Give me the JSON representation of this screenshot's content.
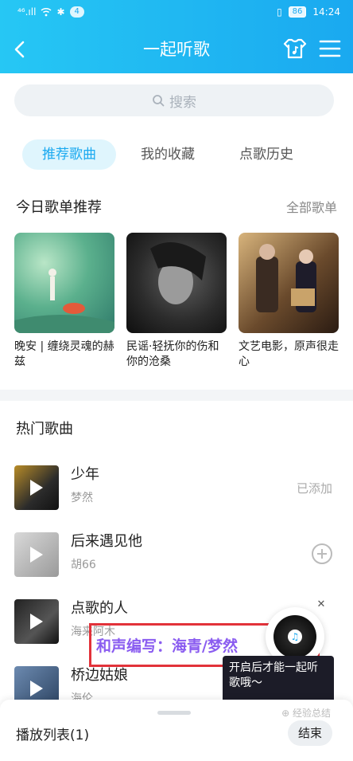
{
  "status_bar": {
    "signal_text": "⁴⁶.ıll",
    "notif_count": "4",
    "battery": "86",
    "time": "14:24"
  },
  "header": {
    "title": "一起听歌",
    "back_icon": "back-chevron-icon",
    "shirt_icon": "tshirt-music-icon",
    "menu_icon": "hamburger-menu-icon"
  },
  "search": {
    "placeholder": "搜索"
  },
  "tabs": [
    {
      "label": "推荐歌曲",
      "active": true
    },
    {
      "label": "我的收藏",
      "active": false
    },
    {
      "label": "点歌历史",
      "active": false
    }
  ],
  "today": {
    "title": "今日歌单推荐",
    "more": "全部歌单",
    "playlists": [
      {
        "name": "晚安 | 缠绕灵魂的赫兹"
      },
      {
        "name": "民谣·轻抚你的伤和你的沧桑"
      },
      {
        "name": "文艺电影，原声很走心"
      }
    ]
  },
  "hot": {
    "title": "热门歌曲",
    "songs": [
      {
        "title": "少年",
        "artist": "梦然",
        "status": "已添加"
      },
      {
        "title": "后来遇见他",
        "artist": "胡66",
        "status": ""
      },
      {
        "title": "点歌的人",
        "artist": "海来阿木",
        "status": ""
      },
      {
        "title": "桥边姑娘",
        "artist": "海伦",
        "status": ""
      }
    ]
  },
  "caption": "和声编写：海青/梦然",
  "tooltip": "开启后才能一起听歌哦～",
  "bottom": {
    "playlist_label": "播放列表(1)",
    "end_label": "结束",
    "watermark": "⊕ 经验总结"
  },
  "colors": {
    "accent": "#1aa9f0",
    "caption_border": "#e2323a",
    "caption_text": "#8a5cf0"
  }
}
